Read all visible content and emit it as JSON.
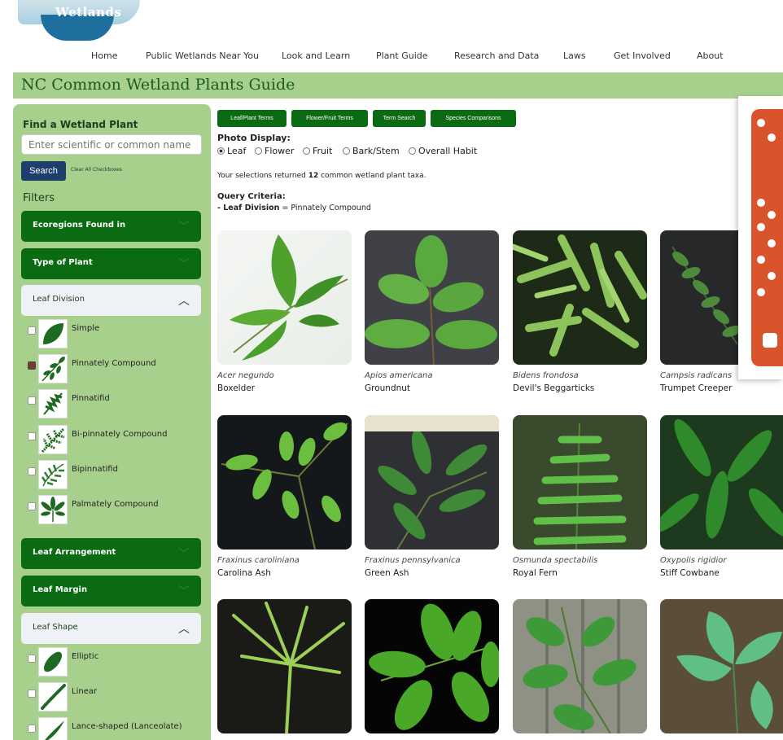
{
  "logo": {
    "text": "Wetlands"
  },
  "nav": [
    "Home",
    "Public Wetlands Near You",
    "Look and Learn",
    "Plant Guide",
    "Research and Data",
    "Laws",
    "Get Involved",
    "About"
  ],
  "page_title": "NC Common Wetland Plants Guide",
  "sidebar": {
    "find_label": "Find a Wetland Plant",
    "search_placeholder": "Enter scientific or common name",
    "search_button": "Search",
    "clear_label": "Clear All Checkboxes",
    "filters_label": "Filters",
    "sections": [
      {
        "label": "Ecoregions Found in",
        "state": "collapsed"
      },
      {
        "label": "Type of Plant",
        "state": "collapsed"
      },
      {
        "label": "Leaf Division",
        "state": "expanded"
      },
      {
        "label": "Leaf Arrangement",
        "state": "collapsed"
      },
      {
        "label": "Leaf Margin",
        "state": "collapsed"
      },
      {
        "label": "Leaf Shape",
        "state": "expanded"
      }
    ],
    "leaf_division_options": [
      {
        "label": "Simple",
        "checked": false
      },
      {
        "label": "Pinnately Compound",
        "checked": true
      },
      {
        "label": "Pinnatifid",
        "checked": false
      },
      {
        "label": "Bi-pinnately Compound",
        "checked": false
      },
      {
        "label": "Bipinnatifid",
        "checked": false
      },
      {
        "label": "Palmately Compound",
        "checked": false
      }
    ],
    "leaf_shape_options": [
      {
        "label": "Elliptic",
        "checked": false
      },
      {
        "label": "Linear",
        "checked": false
      },
      {
        "label": "Lance-shaped (Lanceolate)",
        "checked": false
      }
    ]
  },
  "tabs": [
    "Leaf/Plant Terms",
    "Flower/Fruit Terms",
    "Term Search",
    "Species Comparisons"
  ],
  "photo_display": {
    "label": "Photo Display:",
    "options": [
      "Leaf",
      "Flower",
      "Fruit",
      "Bark/Stem",
      "Overall Habit"
    ],
    "selected": "Leaf"
  },
  "results": {
    "prefix": "Your selections returned ",
    "count": "12",
    "suffix": " common wetland plant taxa."
  },
  "query": {
    "title": "Query Criteria:",
    "key": "- Leaf Division",
    "value": " = Pinnately Compound"
  },
  "plants": [
    {
      "sci": "Acer negundo",
      "common": "Boxelder"
    },
    {
      "sci": "Apios americana",
      "common": "Groundnut"
    },
    {
      "sci": "Bidens frondosa",
      "common": "Devil's Beggarticks"
    },
    {
      "sci": "Campsis radicans",
      "common": "Trumpet Creeper"
    },
    {
      "sci": "Fraxinus caroliniana",
      "common": "Carolina Ash"
    },
    {
      "sci": "Fraxinus pennsylvanica",
      "common": "Green Ash"
    },
    {
      "sci": "Osmunda spectabilis",
      "common": "Royal Fern"
    },
    {
      "sci": "Oxypolis rigidior",
      "common": "Stiff Cowbane"
    }
  ],
  "colors": {
    "brand_green": "#0b6b12",
    "sidebar_green": "#a8d08d",
    "title_green": "#1e5a22",
    "search_blue": "#1e3f6b",
    "accent_orange": "#d9532b"
  }
}
